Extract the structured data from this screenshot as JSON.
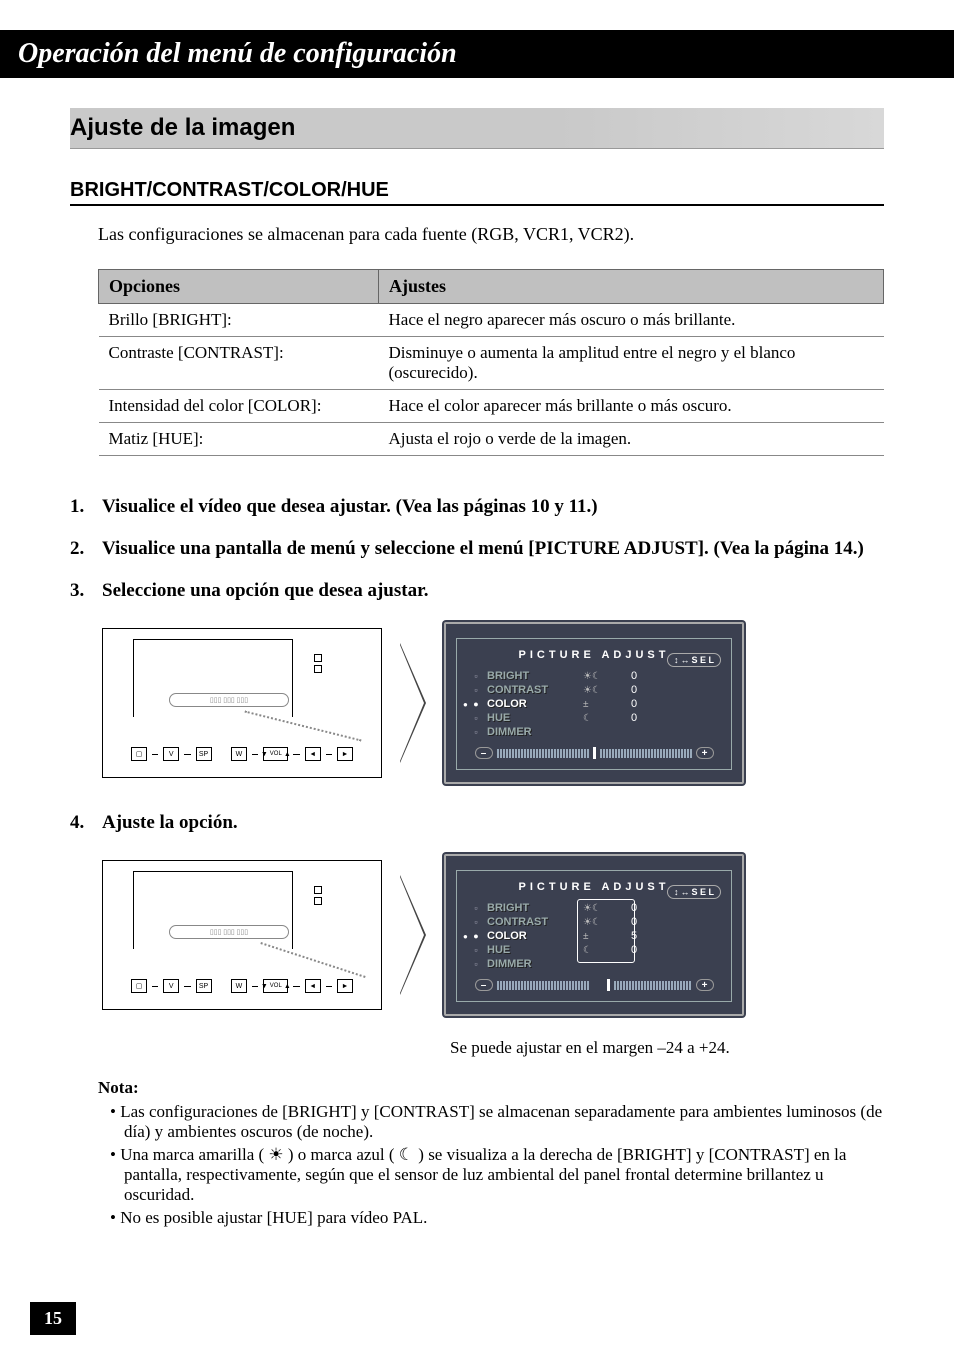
{
  "title_bar": "Operación del menú de configuración",
  "section_header": "Ajuste de la imagen",
  "subsection_header": "BRIGHT/CONTRAST/COLOR/HUE",
  "intro_text": "Las configuraciones se almacenan para cada fuente (RGB, VCR1, VCR2).",
  "table": {
    "headers": {
      "opciones": "Opciones",
      "ajustes": "Ajustes"
    },
    "rows": [
      {
        "label": "Brillo [BRIGHT]:",
        "desc": "Hace el negro aparecer más oscuro o más brillante."
      },
      {
        "label": "Contraste [CONTRAST]:",
        "desc": "Disminuye o aumenta la amplitud entre el negro y el blanco (oscurecido)."
      },
      {
        "label": "Intensidad del color [COLOR]:",
        "desc": "Hace el color aparecer más brillante o más oscuro."
      },
      {
        "label": "Matiz [HUE]:",
        "desc": "Ajusta el rojo o verde de la imagen."
      }
    ]
  },
  "steps": {
    "s1": {
      "num": "1.",
      "text": "Visualice el vídeo que desea ajustar. (Vea las páginas 10 y 11.)"
    },
    "s2": {
      "num": "2.",
      "text": "Visualice una pantalla de menú y seleccione el menú [PICTURE ADJUST]. (Vea la página 14.)"
    },
    "s3": {
      "num": "3.",
      "text": "Seleccione una opción que desea ajustar."
    },
    "s4": {
      "num": "4.",
      "text": "Ajuste la opción."
    }
  },
  "osd": {
    "title": "PICTURE ADJUST",
    "sel_badge": "S E L",
    "rows": {
      "bright": {
        "label": "BRIGHT",
        "sym": "☀☾",
        "val": "0"
      },
      "contrast": {
        "label": "CONTRAST",
        "sym": "☀☾",
        "val": "0"
      },
      "color": {
        "label": "COLOR",
        "sym": "±",
        "val": "0"
      },
      "hue": {
        "label": "HUE",
        "sym": "☾",
        "val": "0"
      },
      "dimmer": {
        "label": "DIMMER",
        "sym": "",
        "val": ""
      }
    },
    "minus": "–",
    "plus": "+"
  },
  "osd2": {
    "color_val": "5"
  },
  "caption_step4": "Se puede ajustar en el margen –24 a +24.",
  "notes": {
    "title": "Nota:",
    "items": [
      "Las configuraciones de [BRIGHT] y [CONTRAST] se almacenan separadamente para ambientes luminosos (de día) y ambientes oscuros (de noche).",
      "Una marca amarilla ( ☀ ) o marca azul ( ☾ ) se visualiza a la derecha de [BRIGHT] y [CONTRAST] en la pantalla, respectivamente, según que el sensor de luz ambiental del panel frontal determine brillantez u oscuridad.",
      "No es posible ajustar [HUE] para vídeo PAL."
    ]
  },
  "page_number": "15",
  "device_buttons": {
    "b1": "▢",
    "b2": "V",
    "b3": "SP",
    "b4": "W",
    "b5": "▼",
    "b6": "VOL",
    "b7": "▲",
    "b8": "◄ ►",
    "b9": "◄",
    "b10": "►"
  }
}
